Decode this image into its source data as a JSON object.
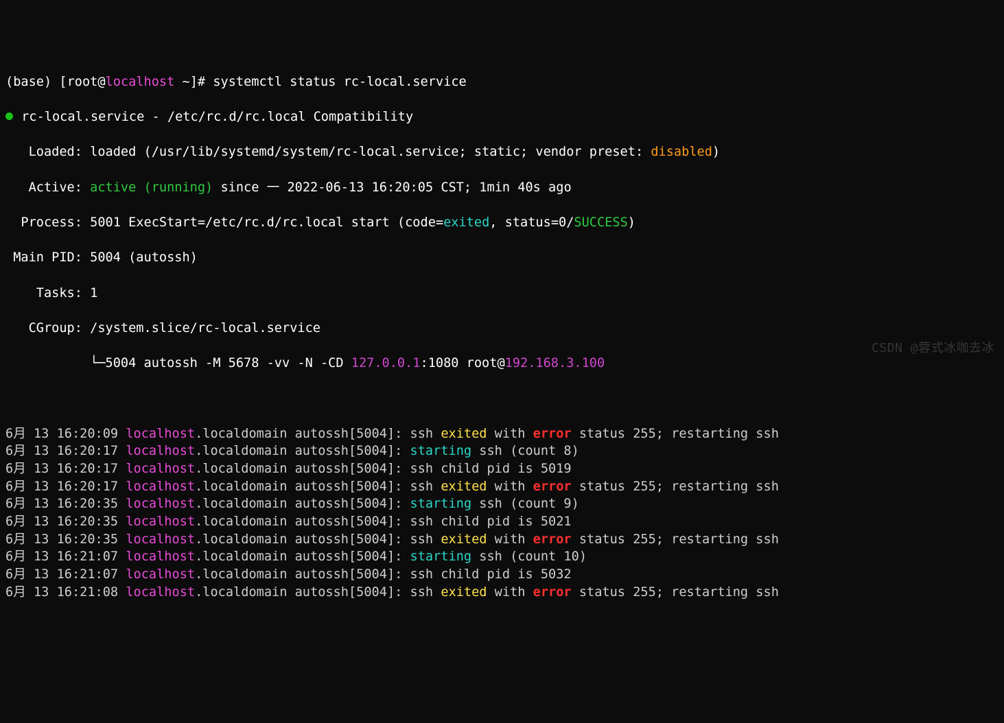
{
  "prompt": {
    "env": "(base)",
    "user": "root",
    "host": "localhost",
    "cwd": "~",
    "symbol": "#",
    "command": "systemctl status rc-local.service"
  },
  "unit": {
    "name": "rc-local.service",
    "sep": " - ",
    "desc": "/etc/rc.d/rc.local Compatibility"
  },
  "loaded": {
    "label": "   Loaded: ",
    "state": "loaded",
    "details_pre": " (/usr/lib/systemd/system/rc-local.service; static; vendor preset: ",
    "preset": "disabled",
    "details_post": ")"
  },
  "active": {
    "label": "   Active: ",
    "state": "active (running)",
    "since_pre": " since ",
    "day": "一",
    "ts": " 2022-06-13 16:20:05 CST; 1min 40s ago"
  },
  "process": {
    "label": "  Process: ",
    "pid": "5001",
    "cmd_pre": " ExecStart=/etc/rc.d/rc.local start (code=",
    "code": "exited",
    "mid": ", status=0/",
    "status": "SUCCESS",
    "end": ")"
  },
  "mainpid": {
    "label": " Main PID: ",
    "val": "5004 (autossh)"
  },
  "tasks": {
    "label": "    Tasks: ",
    "val": "1"
  },
  "cgroup": {
    "label": "   CGroup: ",
    "path": "/system.slice/rc-local.service",
    "branch": "           └─5004 autossh -M 5678 -vv -N -CD ",
    "ip1": "127.0.0.1",
    "port_user": ":1080 root@",
    "ip2": "192.168.3.100"
  },
  "logs": [
    {
      "date": "6月 13 16:20:09",
      "host": "localhost",
      "dom": ".localdomain autossh[5004]: ",
      "msg": [
        {
          "t": "ssh ",
          "c": "grey"
        },
        {
          "t": "exited",
          "c": "yellow"
        },
        {
          "t": " with ",
          "c": "grey"
        },
        {
          "t": "error",
          "c": "redbold"
        },
        {
          "t": " status 255; restarting ssh",
          "c": "grey"
        }
      ]
    },
    {
      "date": "6月 13 16:20:17",
      "host": "localhost",
      "dom": ".localdomain autossh[5004]: ",
      "msg": [
        {
          "t": "starting",
          "c": "cyan"
        },
        {
          "t": " ssh (count 8)",
          "c": "grey"
        }
      ]
    },
    {
      "date": "6月 13 16:20:17",
      "host": "localhost",
      "dom": ".localdomain autossh[5004]: ",
      "msg": [
        {
          "t": "ssh child pid is 5019",
          "c": "grey"
        }
      ]
    },
    {
      "date": "6月 13 16:20:17",
      "host": "localhost",
      "dom": ".localdomain autossh[5004]: ",
      "msg": [
        {
          "t": "ssh ",
          "c": "grey"
        },
        {
          "t": "exited",
          "c": "yellow"
        },
        {
          "t": " with ",
          "c": "grey"
        },
        {
          "t": "error",
          "c": "redbold"
        },
        {
          "t": " status 255; restarting ssh",
          "c": "grey"
        }
      ]
    },
    {
      "date": "6月 13 16:20:35",
      "host": "localhost",
      "dom": ".localdomain autossh[5004]: ",
      "msg": [
        {
          "t": "starting",
          "c": "cyan"
        },
        {
          "t": " ssh (count 9)",
          "c": "grey"
        }
      ]
    },
    {
      "date": "6月 13 16:20:35",
      "host": "localhost",
      "dom": ".localdomain autossh[5004]: ",
      "msg": [
        {
          "t": "ssh child pid is 5021",
          "c": "grey"
        }
      ]
    },
    {
      "date": "6月 13 16:20:35",
      "host": "localhost",
      "dom": ".localdomain autossh[5004]: ",
      "msg": [
        {
          "t": "ssh ",
          "c": "grey"
        },
        {
          "t": "exited",
          "c": "yellow"
        },
        {
          "t": " with ",
          "c": "grey"
        },
        {
          "t": "error",
          "c": "redbold"
        },
        {
          "t": " status 255; restarting ssh",
          "c": "grey"
        }
      ]
    },
    {
      "date": "6月 13 16:21:07",
      "host": "localhost",
      "dom": ".localdomain autossh[5004]: ",
      "msg": [
        {
          "t": "starting",
          "c": "cyan"
        },
        {
          "t": " ssh (count 10)",
          "c": "grey"
        }
      ]
    },
    {
      "date": "6月 13 16:21:07",
      "host": "localhost",
      "dom": ".localdomain autossh[5004]: ",
      "msg": [
        {
          "t": "ssh child pid is 5032",
          "c": "grey"
        }
      ]
    },
    {
      "date": "6月 13 16:21:08",
      "host": "localhost",
      "dom": ".localdomain autossh[5004]: ",
      "msg": [
        {
          "t": "ssh ",
          "c": "grey"
        },
        {
          "t": "exited",
          "c": "yellow"
        },
        {
          "t": " with ",
          "c": "grey"
        },
        {
          "t": "error",
          "c": "redbold"
        },
        {
          "t": " status 255; restarting ssh",
          "c": "grey"
        }
      ]
    }
  ],
  "watermark": "CSDN @蓉式冰咖去冰"
}
